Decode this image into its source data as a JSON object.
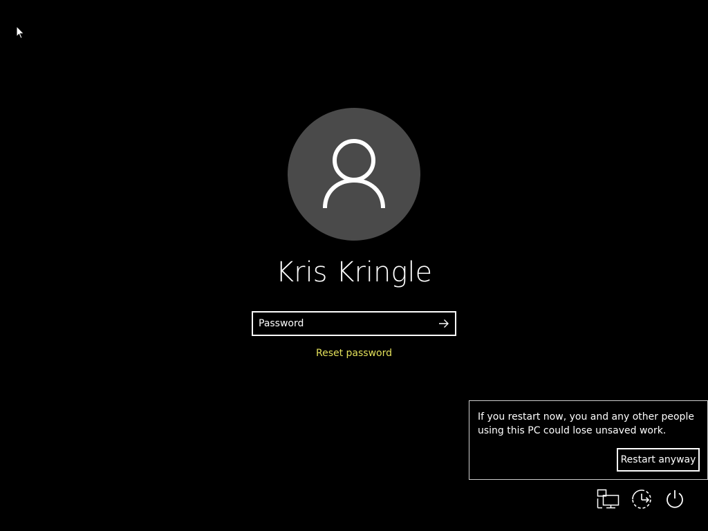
{
  "user": {
    "name": "Kris Kringle"
  },
  "password": {
    "placeholder": "Password",
    "value": ""
  },
  "reset_link": "Reset password",
  "restart_warning": {
    "message": "If you restart now, you and any other people using this PC could lose unsaved work.",
    "button_label": "Restart anyway"
  },
  "tray_icons": [
    "network-icon",
    "ease-of-access-icon",
    "power-icon"
  ],
  "colors": {
    "background": "#000000",
    "avatar": "#4a4a4a",
    "link": "#e3e05a",
    "text": "#ffffff"
  }
}
